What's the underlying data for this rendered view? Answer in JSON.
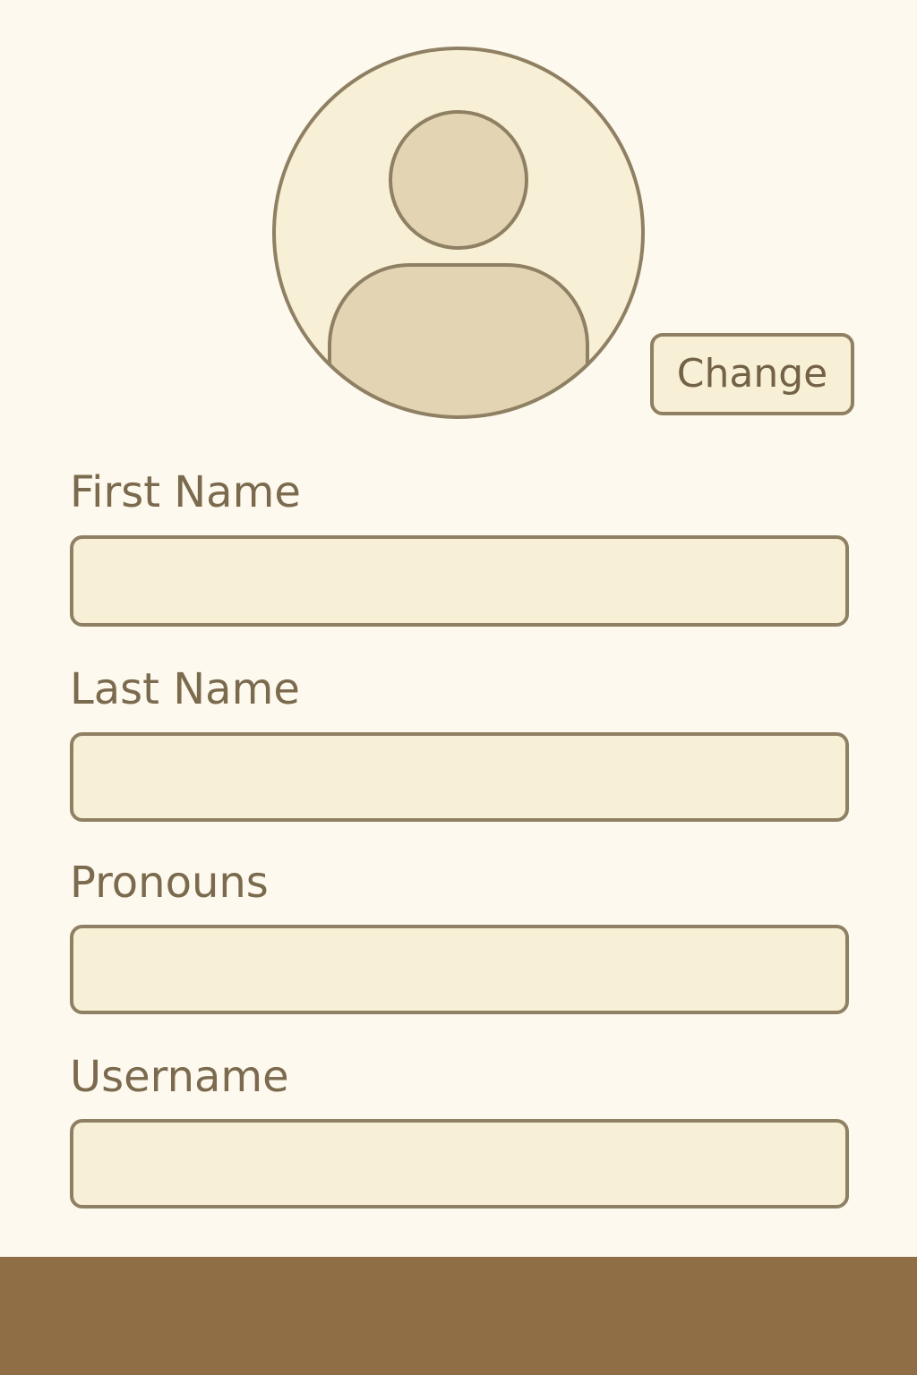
{
  "profile": {
    "avatar_icon": "user-avatar-icon",
    "change_label": "Change"
  },
  "form": {
    "fields": [
      {
        "label": "First Name",
        "value": "",
        "placeholder": ""
      },
      {
        "label": "Last Name",
        "value": "",
        "placeholder": ""
      },
      {
        "label": "Pronouns",
        "value": "",
        "placeholder": ""
      },
      {
        "label": "Username",
        "value": "",
        "placeholder": ""
      }
    ]
  },
  "colors": {
    "background": "#fdf9ee",
    "field_fill": "#f7f0d6",
    "border": "#8f8063",
    "label_text": "#7b6a4d",
    "avatar_figure": "#e3d5b3",
    "footer_bar": "#8f6e45"
  }
}
